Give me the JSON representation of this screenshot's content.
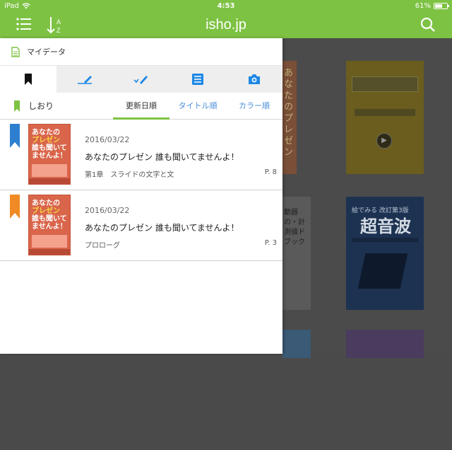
{
  "status_bar": {
    "carrier": "iPad",
    "time": "4:53",
    "battery": "61%"
  },
  "navbar": {
    "title": "isho.jp"
  },
  "panel": {
    "header_title": "マイデータ",
    "bookmark_label": "しおり",
    "sort_tabs": [
      "更新日順",
      "タイトル順",
      "カラー順"
    ],
    "items": [
      {
        "date": "2016/03/22",
        "title": "あなたのプレゼン 誰も聞いてませんよ！",
        "chapter": "第1章　スライドの文字と文",
        "page": "P. 8",
        "ribbon_color": "#2e7fd0"
      },
      {
        "date": "2016/03/22",
        "title": "あなたのプレゼン 誰も聞いてませんよ！",
        "chapter": "プロローグ",
        "page": "P. 3",
        "ribbon_color": "#f08a24"
      }
    ]
  },
  "thumbnail": {
    "line1": "あなたの",
    "line2": "プレゼン",
    "line3": "誰も聞いて",
    "line4": "ませんよ！"
  },
  "shelf": {
    "book1_text": "あなたのプレゼン",
    "book3_text": "動器の・計測値ドブック",
    "book4_small": "絵でみる 改訂第3版",
    "book4_title": "超音波"
  },
  "colors": {
    "accent": "#7dc243",
    "link": "#4a90d9",
    "icon_blue": "#1e88e5"
  }
}
